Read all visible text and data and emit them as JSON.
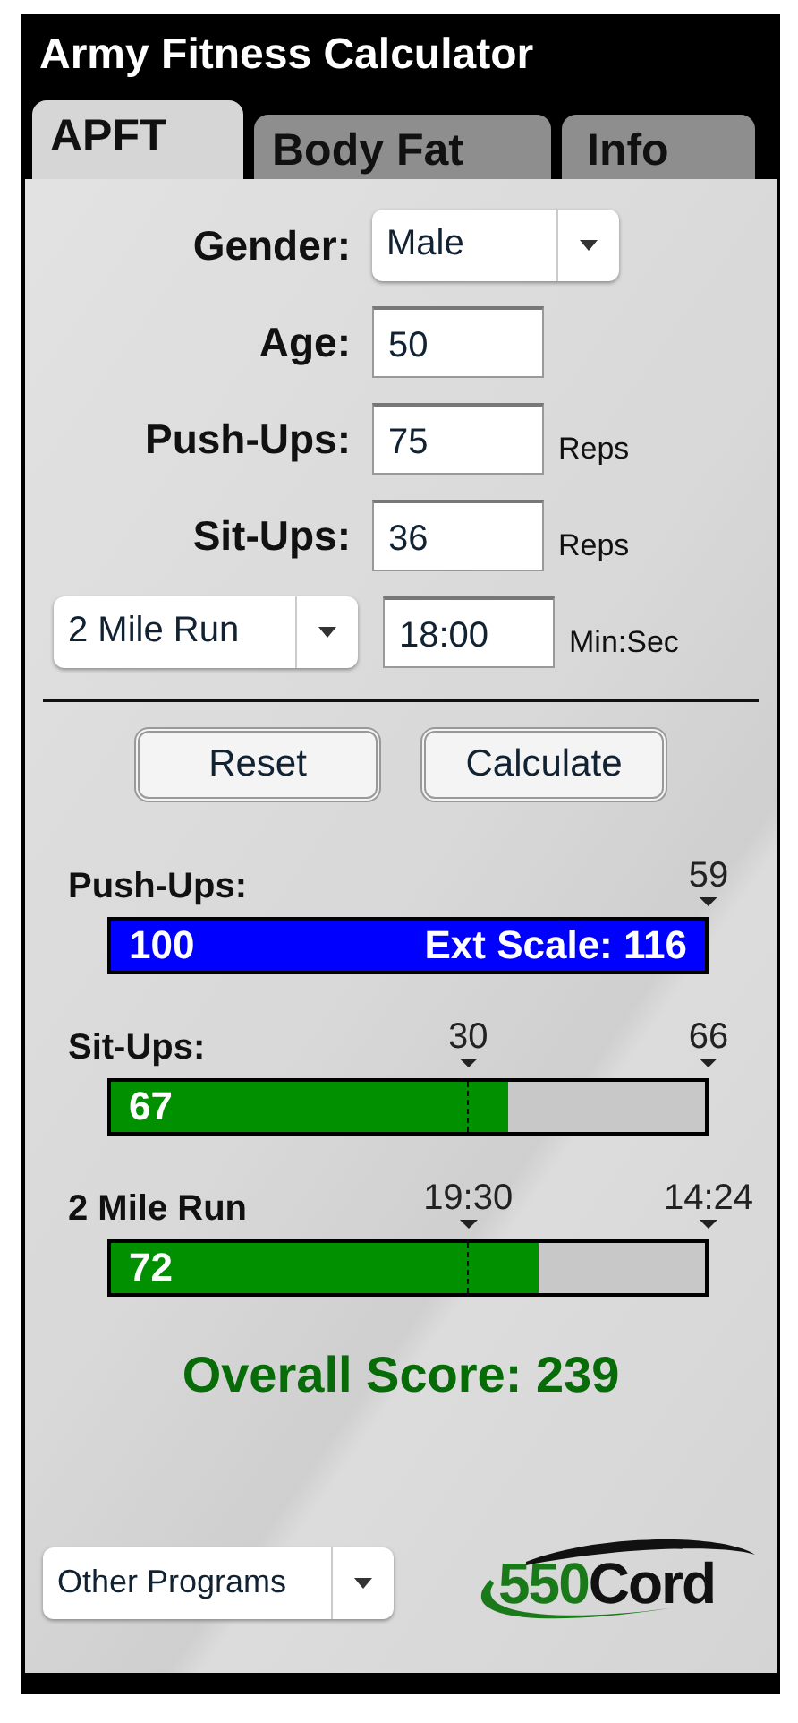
{
  "window": {
    "title": "Army Fitness Calculator"
  },
  "tabs": [
    {
      "label": "APFT",
      "selected": true
    },
    {
      "label": "Body Fat",
      "selected": false
    },
    {
      "label": "Info",
      "selected": false
    }
  ],
  "form": {
    "gender": {
      "label": "Gender:",
      "value": "Male"
    },
    "age": {
      "label": "Age:",
      "value": "50"
    },
    "pushups": {
      "label": "Push-Ups:",
      "value": "75",
      "unit": "Reps"
    },
    "situps": {
      "label": "Sit-Ups:",
      "value": "36",
      "unit": "Reps"
    },
    "run": {
      "event": "2 Mile Run",
      "value": "18:00",
      "unit": "Min:Sec"
    }
  },
  "buttons": [
    "Reset",
    "Calculate"
  ],
  "results": [
    {
      "label": "Push-Ups:",
      "score": "100",
      "extra": "Ext Scale: 116",
      "level": 1,
      "color": "#0000ff",
      "max_label": "59"
    },
    {
      "label": "Sit-Ups:",
      "score": "67",
      "level": 0.67,
      "color": "#009000",
      "pass_label": "30",
      "max_label": "66"
    },
    {
      "label": "2 Mile Run",
      "score": "72",
      "level": 0.72,
      "color": "#009000",
      "pass_label": "19:30",
      "max_label": "14:24"
    }
  ],
  "overall": "Overall Score: 239",
  "footer": {
    "programs": "Other Programs",
    "logo": {
      "number": "550",
      "word": "Cord"
    }
  }
}
